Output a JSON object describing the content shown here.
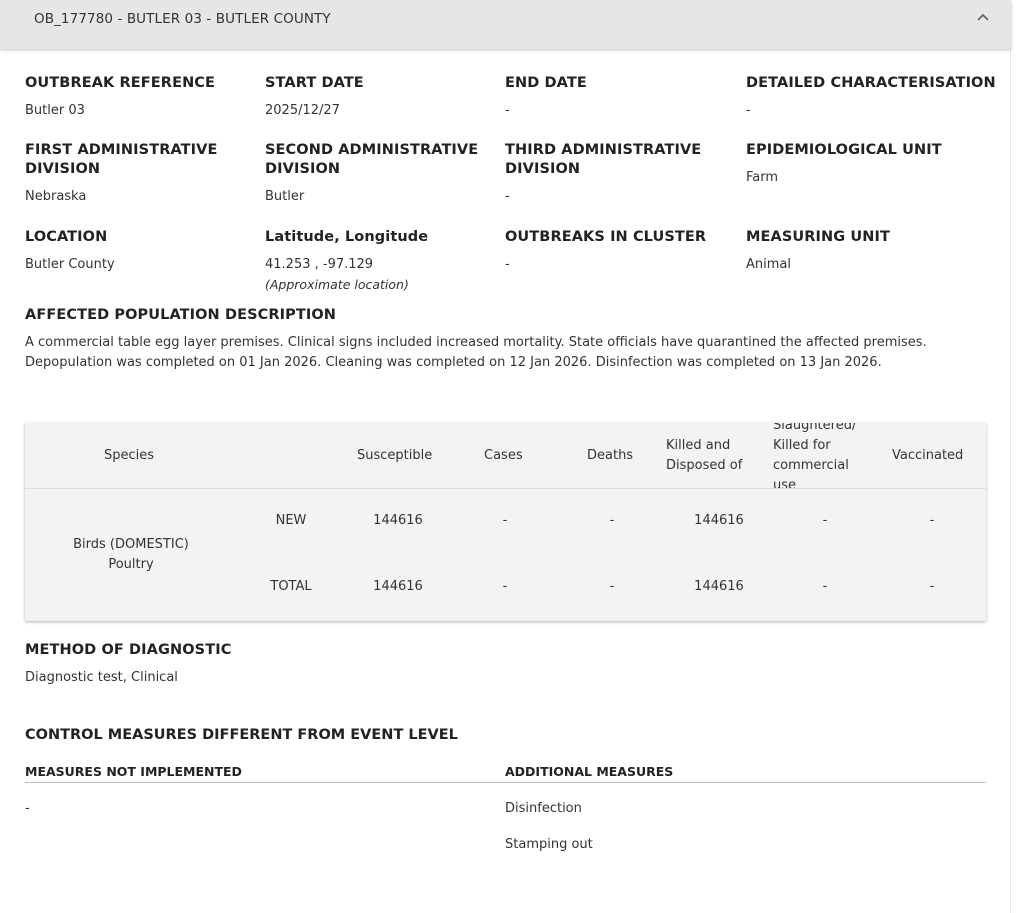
{
  "header": {
    "title": "OB_177780 - BUTLER 03 - BUTLER COUNTY",
    "toggle_icon": "chevron-up-icon"
  },
  "fields": {
    "outbreak_reference": {
      "label": "OUTBREAK REFERENCE",
      "value": "Butler 03"
    },
    "start_date": {
      "label": "START DATE",
      "value": "2025/12/27"
    },
    "end_date": {
      "label": "END DATE",
      "value": "-"
    },
    "detailed_characterisation": {
      "label": "DETAILED CHARACTERISATION",
      "value": "-"
    },
    "first_admin_division": {
      "label_line1": "FIRST ADMINISTRATIVE",
      "label_line2": "DIVISION",
      "value": "Nebraska"
    },
    "second_admin_division": {
      "label_line1": "SECOND ADMINISTRATIVE",
      "label_line2": "DIVISION",
      "value": "Butler"
    },
    "third_admin_division": {
      "label_line1": "THIRD ADMINISTRATIVE",
      "label_line2": "DIVISION",
      "value": "-"
    },
    "epidemiological_unit": {
      "label": "EPIDEMIOLOGICAL UNIT",
      "value": "Farm"
    },
    "location": {
      "label": "LOCATION",
      "value": "Butler County"
    },
    "lat_long": {
      "label": "Latitude, Longitude",
      "value": "41.253 , -97.129",
      "note": "(Approximate location)"
    },
    "outbreaks_in_cluster": {
      "label": "OUTBREAKS IN CLUSTER",
      "value": "-"
    },
    "measuring_unit": {
      "label": "MEASURING UNIT",
      "value": "Animal"
    }
  },
  "affected_population": {
    "label": "AFFECTED POPULATION DESCRIPTION",
    "text": "A commercial table egg layer premises. Clinical signs included increased mortality. State officials have quarantined the affected premises. Depopulation was completed on 01 Jan 2026. Cleaning was completed on 12 Jan 2026. Disinfection was completed on 13 Jan 2026."
  },
  "table": {
    "headers": {
      "species": "Species",
      "susceptible": "Susceptible",
      "cases": "Cases",
      "deaths": "Deaths",
      "killed_line1": "Killed and",
      "killed_line2": "Disposed of",
      "slaughtered_line0": "Slaughtered/",
      "slaughtered_line1": "Killed for",
      "slaughtered_line2": "commercial",
      "slaughtered_line3": "use",
      "vaccinated": "Vaccinated"
    },
    "species_line1": "Birds (DOMESTIC)",
    "species_line2": "Poultry",
    "rows": [
      {
        "type": "NEW",
        "susceptible": "144616",
        "cases": "-",
        "deaths": "-",
        "killed": "144616",
        "slaughtered": "-",
        "vaccinated": "-"
      },
      {
        "type": "TOTAL",
        "susceptible": "144616",
        "cases": "-",
        "deaths": "-",
        "killed": "144616",
        "slaughtered": "-",
        "vaccinated": "-"
      }
    ]
  },
  "diagnostic": {
    "label": "METHOD OF DIAGNOSTIC",
    "value": "Diagnostic test, Clinical"
  },
  "control_measures": {
    "title": "CONTROL MEASURES DIFFERENT FROM EVENT LEVEL",
    "not_implemented_label": "MEASURES NOT IMPLEMENTED",
    "not_implemented_value": "-",
    "additional_label": "ADDITIONAL MEASURES",
    "additional_items": [
      "Disinfection",
      "Stamping out"
    ]
  }
}
